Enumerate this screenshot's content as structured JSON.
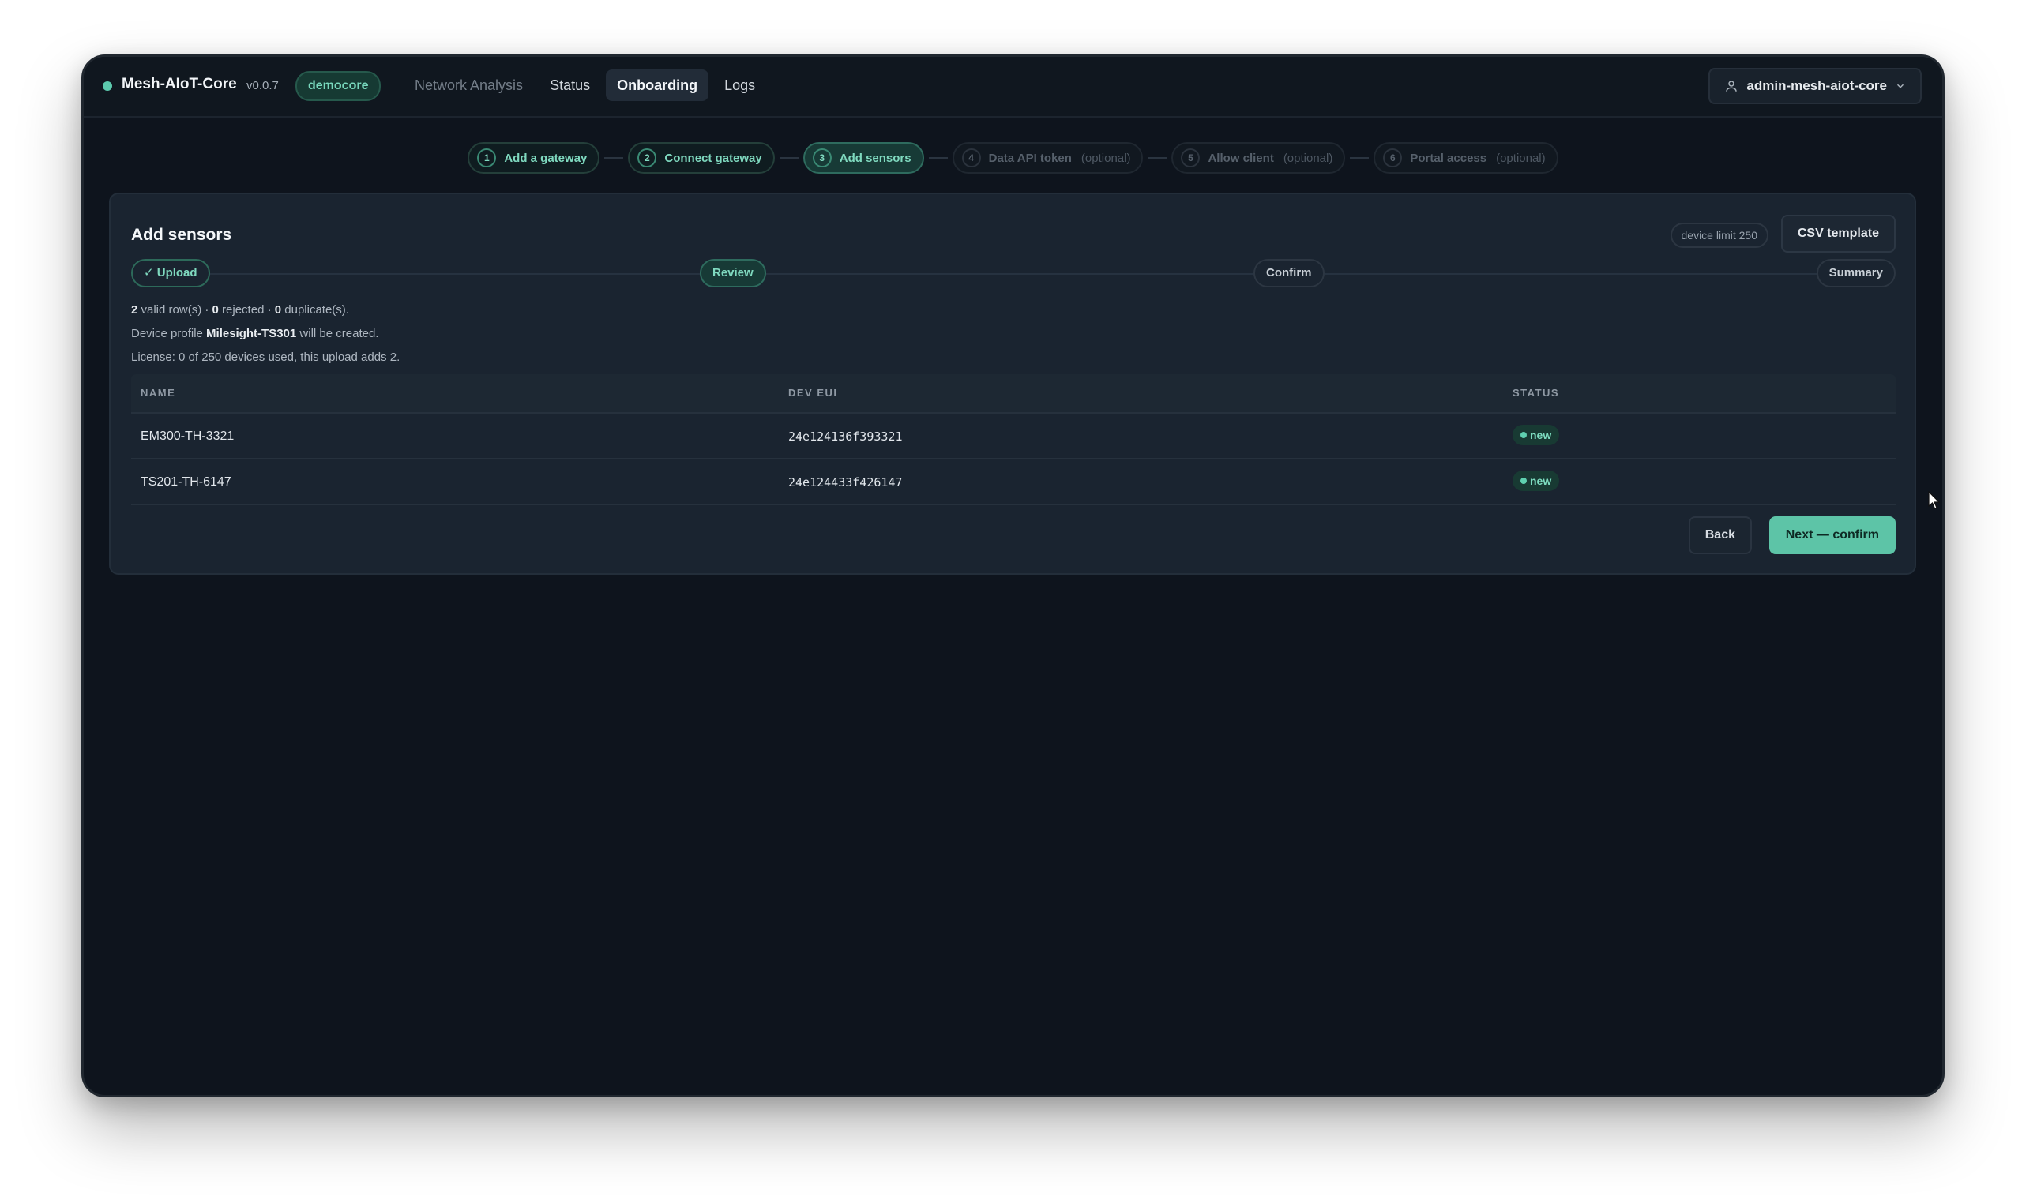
{
  "header": {
    "app_name": "Mesh-AIoT-Core",
    "version": "v0.0.7",
    "tenant": "democore",
    "nav": [
      {
        "label": "Network Analysis"
      },
      {
        "label": "Status"
      },
      {
        "label": "Onboarding"
      },
      {
        "label": "Logs"
      }
    ],
    "user": "admin-mesh-aiot-core"
  },
  "wizard_steps": [
    {
      "num": "1",
      "label": "Add a gateway",
      "optional": ""
    },
    {
      "num": "2",
      "label": "Connect gateway",
      "optional": ""
    },
    {
      "num": "3",
      "label": "Add sensors",
      "optional": ""
    },
    {
      "num": "4",
      "label": "Data API token",
      "optional": "(optional)"
    },
    {
      "num": "5",
      "label": "Allow client",
      "optional": "(optional)"
    },
    {
      "num": "6",
      "label": "Portal access",
      "optional": "(optional)"
    }
  ],
  "panel": {
    "title": "Add sensors",
    "device_limit": "device limit 250",
    "csv_button": "CSV template",
    "substeps": {
      "upload": "✓ Upload",
      "review": "Review",
      "confirm": "Confirm",
      "summary": "Summary"
    },
    "info": {
      "valid_count": "2",
      "valid_text": " valid row(s) · ",
      "rejected_count": "0",
      "rejected_text": " rejected · ",
      "duplicate_count": "0",
      "duplicate_text": " duplicate(s).",
      "profile_prefix": "Device profile ",
      "profile_name": "Milesight-TS301",
      "profile_suffix": " will be created.",
      "license": "License: 0 of 250 devices used, this upload adds 2."
    },
    "table": {
      "columns": [
        "NAME",
        "DEV EUI",
        "STATUS"
      ],
      "rows": [
        {
          "name": "EM300-TH-3321",
          "dev_eui": "24e124136f393321",
          "status": "new"
        },
        {
          "name": "TS201-TH-6147",
          "dev_eui": "24e124433f426147",
          "status": "new"
        }
      ]
    },
    "back_button": "Back",
    "next_button": "Next — confirm"
  },
  "colors": {
    "accent": "#5dc4a7",
    "background": "#0e141d",
    "panel": "#1a2430"
  }
}
